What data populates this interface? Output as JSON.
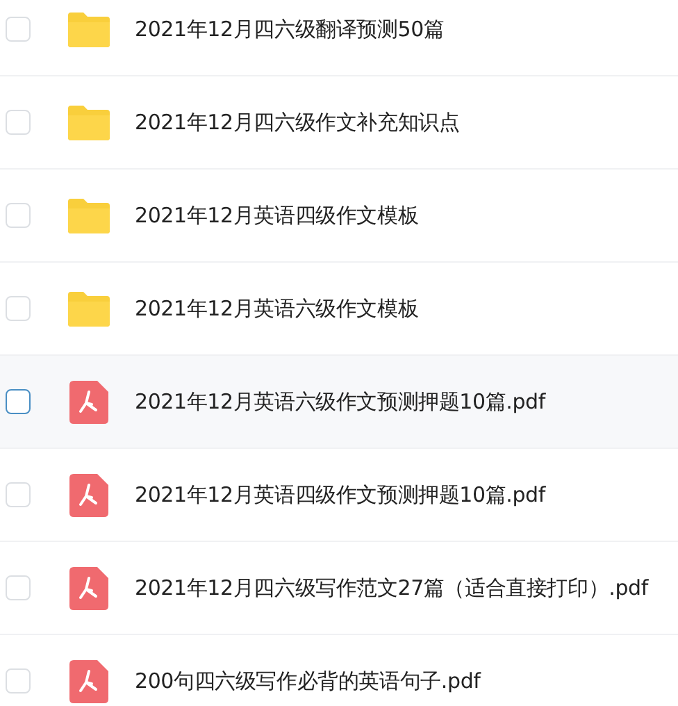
{
  "files": [
    {
      "kind": "folder",
      "name": "2021年12月四六级翻译预测50篇",
      "checked": false,
      "highlighted": false
    },
    {
      "kind": "folder",
      "name": "2021年12月四六级作文补充知识点",
      "checked": false,
      "highlighted": false
    },
    {
      "kind": "folder",
      "name": "2021年12月英语四级作文模板",
      "checked": false,
      "highlighted": false
    },
    {
      "kind": "folder",
      "name": "2021年12月英语六级作文模板",
      "checked": false,
      "highlighted": false
    },
    {
      "kind": "pdf",
      "name": "2021年12月英语六级作文预测押题10篇.pdf",
      "checked": false,
      "highlighted": true
    },
    {
      "kind": "pdf",
      "name": "2021年12月英语四级作文预测押题10篇.pdf",
      "checked": false,
      "highlighted": false
    },
    {
      "kind": "pdf",
      "name": "2021年12月四六级写作范文27篇（适合直接打印）.pdf",
      "checked": false,
      "highlighted": false
    },
    {
      "kind": "pdf",
      "name": "200句四六级写作必背的英语句子.pdf",
      "checked": false,
      "highlighted": false
    }
  ]
}
